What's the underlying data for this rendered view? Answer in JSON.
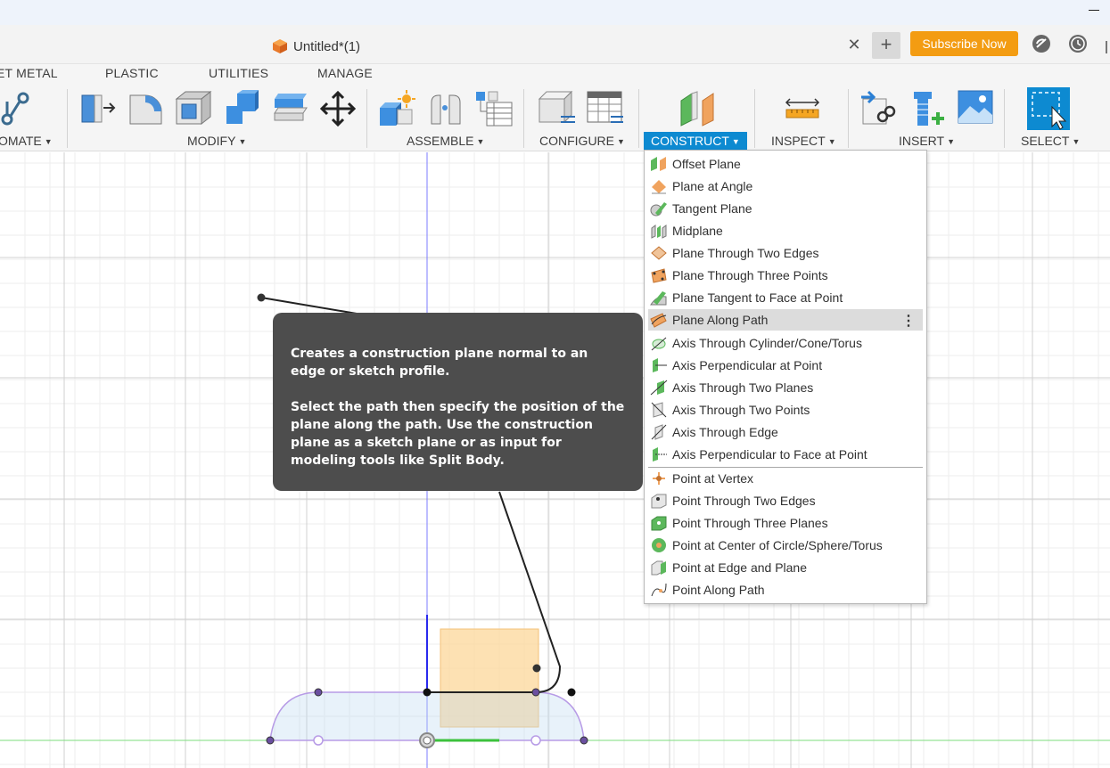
{
  "document": {
    "title": "Untitled*(1)",
    "close_icon": "close-icon",
    "new_tab_icon": "plus-icon"
  },
  "header": {
    "subscribe_label": "Subscribe Now"
  },
  "tabs": [
    "ET METAL",
    "PLASTIC",
    "UTILITIES",
    "MANAGE"
  ],
  "groups": {
    "automate": "OMATE",
    "modify": "MODIFY",
    "assemble": "ASSEMBLE",
    "configure": "CONFIGURE",
    "construct": "CONSTRUCT",
    "inspect": "INSPECT",
    "insert": "INSERT",
    "select": "SELECT"
  },
  "construct_menu": {
    "items": [
      {
        "label": "Offset Plane",
        "icon": "offset-plane-icon"
      },
      {
        "label": "Plane at Angle",
        "icon": "plane-at-angle-icon"
      },
      {
        "label": "Tangent Plane",
        "icon": "tangent-plane-icon"
      },
      {
        "label": "Midplane",
        "icon": "midplane-icon"
      },
      {
        "label": "Plane Through Two Edges",
        "icon": "plane-two-edges-icon"
      },
      {
        "label": "Plane Through Three Points",
        "icon": "plane-three-points-icon"
      },
      {
        "label": "Plane Tangent to Face at Point",
        "icon": "plane-tangent-face-icon"
      },
      {
        "label": "Plane Along Path",
        "icon": "plane-along-path-icon",
        "highlighted": true
      },
      {
        "label": "Axis Through Cylinder/Cone/Torus",
        "icon": "axis-cylinder-icon"
      },
      {
        "label": "Axis Perpendicular at Point",
        "icon": "axis-perpendicular-icon"
      },
      {
        "label": "Axis Through Two Planes",
        "icon": "axis-two-planes-icon"
      },
      {
        "label": "Axis Through Two Points",
        "icon": "axis-two-points-icon"
      },
      {
        "label": "Axis Through Edge",
        "icon": "axis-edge-icon"
      },
      {
        "label": "Axis Perpendicular to Face at Point",
        "icon": "axis-perp-face-icon"
      },
      {
        "label": "Point at Vertex",
        "icon": "point-vertex-icon"
      },
      {
        "label": "Point Through Two Edges",
        "icon": "point-two-edges-icon"
      },
      {
        "label": "Point Through Three Planes",
        "icon": "point-three-planes-icon"
      },
      {
        "label": "Point at Center of Circle/Sphere/Torus",
        "icon": "point-center-icon"
      },
      {
        "label": "Point at Edge and Plane",
        "icon": "point-edge-plane-icon"
      },
      {
        "label": "Point Along Path",
        "icon": "point-along-path-icon"
      }
    ],
    "more_icon": "more-vertical-icon"
  },
  "tooltip": {
    "line1": "Creates a construction plane normal to an edge or sketch profile.",
    "line2": "Select the path then specify the position of the plane along the path. Use the construction plane as a sketch plane or as input for modeling tools like Split Body."
  },
  "colors": {
    "accent": "#0d8ad1",
    "subscribe": "#f39c12",
    "tooltip_bg": "#4d4d4d",
    "menu_highlight": "#dcdcdc"
  }
}
